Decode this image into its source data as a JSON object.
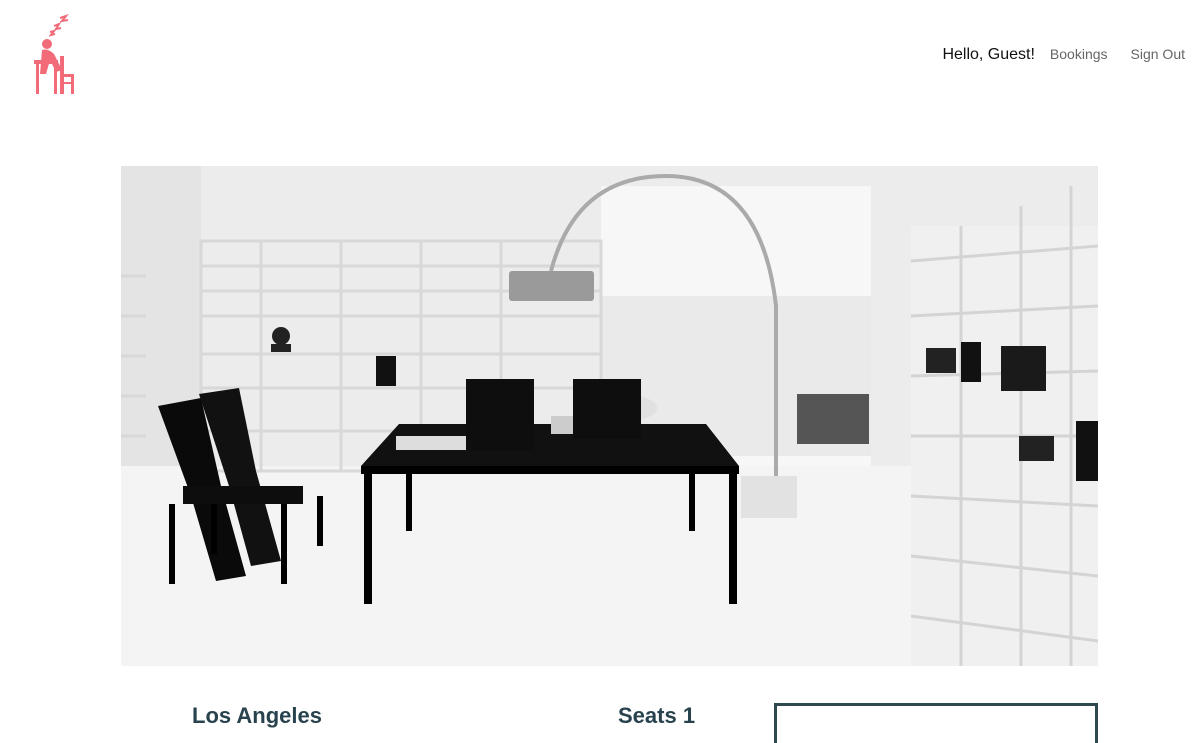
{
  "header": {
    "logo_icon": "sleeping-person-at-desk-icon",
    "logo_color": "#f16b78",
    "greeting": "Hello, Guest!",
    "nav_links": [
      "Bookings",
      "Sign Out"
    ]
  },
  "hero": {
    "image_desc_icon": "interior-room-photo"
  },
  "listing": {
    "city": "Los Angeles",
    "seats": "Seats 1"
  },
  "colors": {
    "heading": "#29434e",
    "box_border": "#2f4a4f"
  }
}
